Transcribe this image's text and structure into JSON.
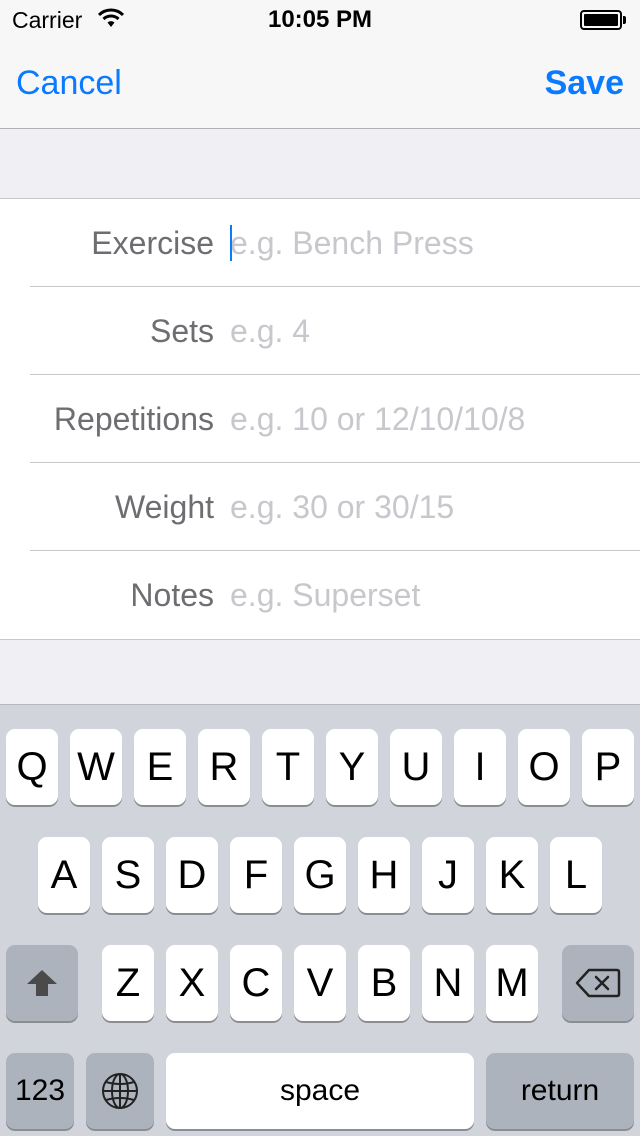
{
  "status_bar": {
    "carrier": "Carrier",
    "time": "10:05 PM"
  },
  "nav": {
    "cancel_label": "Cancel",
    "save_label": "Save"
  },
  "form": {
    "fields": [
      {
        "label": "Exercise",
        "placeholder": "e.g. Bench Press"
      },
      {
        "label": "Sets",
        "placeholder": "e.g. 4"
      },
      {
        "label": "Repetitions",
        "placeholder": "e.g. 10 or 12/10/10/8"
      },
      {
        "label": "Weight",
        "placeholder": "e.g. 30 or 30/15"
      },
      {
        "label": "Notes",
        "placeholder": "e.g. Superset"
      }
    ]
  },
  "keyboard": {
    "row1": [
      "Q",
      "W",
      "E",
      "R",
      "T",
      "Y",
      "U",
      "I",
      "O",
      "P"
    ],
    "row2": [
      "A",
      "S",
      "D",
      "F",
      "G",
      "H",
      "J",
      "K",
      "L"
    ],
    "row3": [
      "Z",
      "X",
      "C",
      "V",
      "B",
      "N",
      "M"
    ],
    "numbers_label": "123",
    "space_label": "space",
    "return_label": "return",
    "icons": {
      "shift": "shift-icon",
      "delete": "delete-icon",
      "globe": "globe-icon"
    }
  },
  "colors": {
    "accent": "#0a7aff",
    "label": "#6d6d72",
    "placeholder": "#c7c7cd",
    "keyboard_bg": "#d1d5db"
  }
}
